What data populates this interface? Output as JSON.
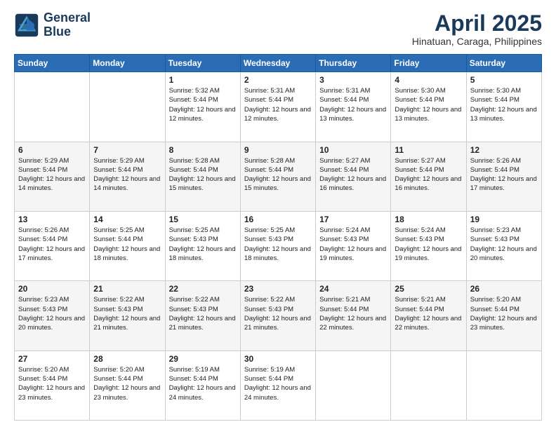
{
  "logo": {
    "line1": "General",
    "line2": "Blue"
  },
  "title": "April 2025",
  "subtitle": "Hinatuan, Caraga, Philippines",
  "weekdays": [
    "Sunday",
    "Monday",
    "Tuesday",
    "Wednesday",
    "Thursday",
    "Friday",
    "Saturday"
  ],
  "weeks": [
    [
      {
        "day": "",
        "sunrise": "",
        "sunset": "",
        "daylight": ""
      },
      {
        "day": "",
        "sunrise": "",
        "sunset": "",
        "daylight": ""
      },
      {
        "day": "1",
        "sunrise": "Sunrise: 5:32 AM",
        "sunset": "Sunset: 5:44 PM",
        "daylight": "Daylight: 12 hours and 12 minutes."
      },
      {
        "day": "2",
        "sunrise": "Sunrise: 5:31 AM",
        "sunset": "Sunset: 5:44 PM",
        "daylight": "Daylight: 12 hours and 12 minutes."
      },
      {
        "day": "3",
        "sunrise": "Sunrise: 5:31 AM",
        "sunset": "Sunset: 5:44 PM",
        "daylight": "Daylight: 12 hours and 13 minutes."
      },
      {
        "day": "4",
        "sunrise": "Sunrise: 5:30 AM",
        "sunset": "Sunset: 5:44 PM",
        "daylight": "Daylight: 12 hours and 13 minutes."
      },
      {
        "day": "5",
        "sunrise": "Sunrise: 5:30 AM",
        "sunset": "Sunset: 5:44 PM",
        "daylight": "Daylight: 12 hours and 13 minutes."
      }
    ],
    [
      {
        "day": "6",
        "sunrise": "Sunrise: 5:29 AM",
        "sunset": "Sunset: 5:44 PM",
        "daylight": "Daylight: 12 hours and 14 minutes."
      },
      {
        "day": "7",
        "sunrise": "Sunrise: 5:29 AM",
        "sunset": "Sunset: 5:44 PM",
        "daylight": "Daylight: 12 hours and 14 minutes."
      },
      {
        "day": "8",
        "sunrise": "Sunrise: 5:28 AM",
        "sunset": "Sunset: 5:44 PM",
        "daylight": "Daylight: 12 hours and 15 minutes."
      },
      {
        "day": "9",
        "sunrise": "Sunrise: 5:28 AM",
        "sunset": "Sunset: 5:44 PM",
        "daylight": "Daylight: 12 hours and 15 minutes."
      },
      {
        "day": "10",
        "sunrise": "Sunrise: 5:27 AM",
        "sunset": "Sunset: 5:44 PM",
        "daylight": "Daylight: 12 hours and 16 minutes."
      },
      {
        "day": "11",
        "sunrise": "Sunrise: 5:27 AM",
        "sunset": "Sunset: 5:44 PM",
        "daylight": "Daylight: 12 hours and 16 minutes."
      },
      {
        "day": "12",
        "sunrise": "Sunrise: 5:26 AM",
        "sunset": "Sunset: 5:44 PM",
        "daylight": "Daylight: 12 hours and 17 minutes."
      }
    ],
    [
      {
        "day": "13",
        "sunrise": "Sunrise: 5:26 AM",
        "sunset": "Sunset: 5:44 PM",
        "daylight": "Daylight: 12 hours and 17 minutes."
      },
      {
        "day": "14",
        "sunrise": "Sunrise: 5:25 AM",
        "sunset": "Sunset: 5:44 PM",
        "daylight": "Daylight: 12 hours and 18 minutes."
      },
      {
        "day": "15",
        "sunrise": "Sunrise: 5:25 AM",
        "sunset": "Sunset: 5:43 PM",
        "daylight": "Daylight: 12 hours and 18 minutes."
      },
      {
        "day": "16",
        "sunrise": "Sunrise: 5:25 AM",
        "sunset": "Sunset: 5:43 PM",
        "daylight": "Daylight: 12 hours and 18 minutes."
      },
      {
        "day": "17",
        "sunrise": "Sunrise: 5:24 AM",
        "sunset": "Sunset: 5:43 PM",
        "daylight": "Daylight: 12 hours and 19 minutes."
      },
      {
        "day": "18",
        "sunrise": "Sunrise: 5:24 AM",
        "sunset": "Sunset: 5:43 PM",
        "daylight": "Daylight: 12 hours and 19 minutes."
      },
      {
        "day": "19",
        "sunrise": "Sunrise: 5:23 AM",
        "sunset": "Sunset: 5:43 PM",
        "daylight": "Daylight: 12 hours and 20 minutes."
      }
    ],
    [
      {
        "day": "20",
        "sunrise": "Sunrise: 5:23 AM",
        "sunset": "Sunset: 5:43 PM",
        "daylight": "Daylight: 12 hours and 20 minutes."
      },
      {
        "day": "21",
        "sunrise": "Sunrise: 5:22 AM",
        "sunset": "Sunset: 5:43 PM",
        "daylight": "Daylight: 12 hours and 21 minutes."
      },
      {
        "day": "22",
        "sunrise": "Sunrise: 5:22 AM",
        "sunset": "Sunset: 5:43 PM",
        "daylight": "Daylight: 12 hours and 21 minutes."
      },
      {
        "day": "23",
        "sunrise": "Sunrise: 5:22 AM",
        "sunset": "Sunset: 5:43 PM",
        "daylight": "Daylight: 12 hours and 21 minutes."
      },
      {
        "day": "24",
        "sunrise": "Sunrise: 5:21 AM",
        "sunset": "Sunset: 5:44 PM",
        "daylight": "Daylight: 12 hours and 22 minutes."
      },
      {
        "day": "25",
        "sunrise": "Sunrise: 5:21 AM",
        "sunset": "Sunset: 5:44 PM",
        "daylight": "Daylight: 12 hours and 22 minutes."
      },
      {
        "day": "26",
        "sunrise": "Sunrise: 5:20 AM",
        "sunset": "Sunset: 5:44 PM",
        "daylight": "Daylight: 12 hours and 23 minutes."
      }
    ],
    [
      {
        "day": "27",
        "sunrise": "Sunrise: 5:20 AM",
        "sunset": "Sunset: 5:44 PM",
        "daylight": "Daylight: 12 hours and 23 minutes."
      },
      {
        "day": "28",
        "sunrise": "Sunrise: 5:20 AM",
        "sunset": "Sunset: 5:44 PM",
        "daylight": "Daylight: 12 hours and 23 minutes."
      },
      {
        "day": "29",
        "sunrise": "Sunrise: 5:19 AM",
        "sunset": "Sunset: 5:44 PM",
        "daylight": "Daylight: 12 hours and 24 minutes."
      },
      {
        "day": "30",
        "sunrise": "Sunrise: 5:19 AM",
        "sunset": "Sunset: 5:44 PM",
        "daylight": "Daylight: 12 hours and 24 minutes."
      },
      {
        "day": "",
        "sunrise": "",
        "sunset": "",
        "daylight": ""
      },
      {
        "day": "",
        "sunrise": "",
        "sunset": "",
        "daylight": ""
      },
      {
        "day": "",
        "sunrise": "",
        "sunset": "",
        "daylight": ""
      }
    ]
  ]
}
